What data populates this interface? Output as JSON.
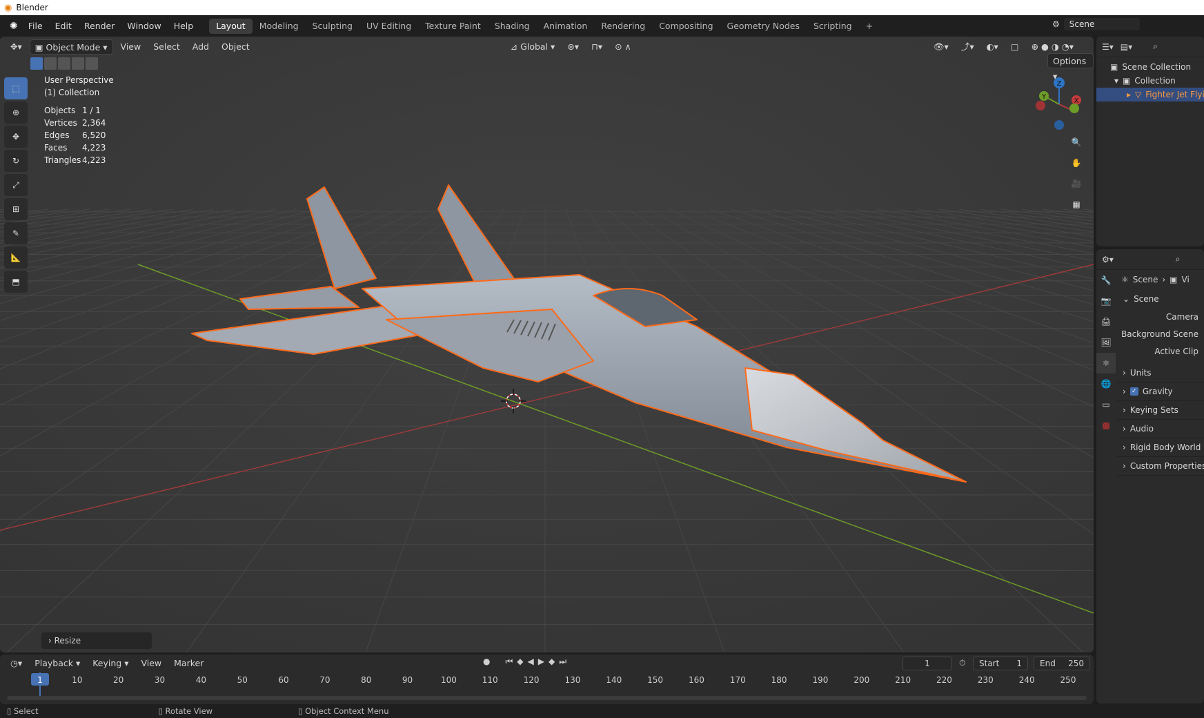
{
  "window": {
    "title": "Blender"
  },
  "menu": [
    "File",
    "Edit",
    "Render",
    "Window",
    "Help"
  ],
  "workspaces": [
    "Layout",
    "Modeling",
    "Sculpting",
    "UV Editing",
    "Texture Paint",
    "Shading",
    "Animation",
    "Rendering",
    "Compositing",
    "Geometry Nodes",
    "Scripting"
  ],
  "active_workspace": "Layout",
  "add_workspace": "+",
  "scene_name": "Scene",
  "viewport": {
    "mode": "Object Mode",
    "menus": [
      "View",
      "Select",
      "Add",
      "Object"
    ],
    "orientation": "Global",
    "options": "Options",
    "overlay_title": "User Perspective",
    "overlay_collection": "(1) Collection",
    "stats": [
      {
        "label": "Objects",
        "value": "1 / 1"
      },
      {
        "label": "Vertices",
        "value": "2,364"
      },
      {
        "label": "Edges",
        "value": "6,520"
      },
      {
        "label": "Faces",
        "value": "4,223"
      },
      {
        "label": "Triangles",
        "value": "4,223"
      }
    ],
    "gizmo_axes": [
      "Z",
      "Y",
      "X"
    ],
    "resize_panel": "Resize"
  },
  "outliner": {
    "items": [
      "Scene Collection",
      "Collection",
      "Fighter Jet Flyi"
    ]
  },
  "properties": {
    "breadcrumb": [
      "Scene",
      "Vi"
    ],
    "section": "Scene",
    "rows": [
      "Camera",
      "Background Scene",
      "Active Clip"
    ],
    "subsections": [
      {
        "label": "Units",
        "checked": null
      },
      {
        "label": "Gravity",
        "checked": true
      },
      {
        "label": "Keying Sets",
        "checked": null
      },
      {
        "label": "Audio",
        "checked": null
      },
      {
        "label": "Rigid Body World",
        "checked": null
      },
      {
        "label": "Custom Properties",
        "checked": null
      }
    ]
  },
  "timeline": {
    "menus": [
      "Playback",
      "Keying",
      "View",
      "Marker"
    ],
    "current_frame": "1",
    "start_label": "Start",
    "start": "1",
    "end_label": "End",
    "end": "250",
    "ticks": [
      "1",
      "10",
      "20",
      "30",
      "40",
      "50",
      "60",
      "70",
      "80",
      "90",
      "100",
      "110",
      "120",
      "130",
      "140",
      "150",
      "160",
      "170",
      "180",
      "190",
      "200",
      "210",
      "220",
      "230",
      "240",
      "250"
    ]
  },
  "statusbar": [
    "Select",
    "Rotate View",
    "Object Context Menu"
  ],
  "colors": {
    "accent": "#4772b3",
    "selection": "#ff6a1a",
    "x_axis": "#b33a3a",
    "y_axis": "#6e9c28"
  }
}
